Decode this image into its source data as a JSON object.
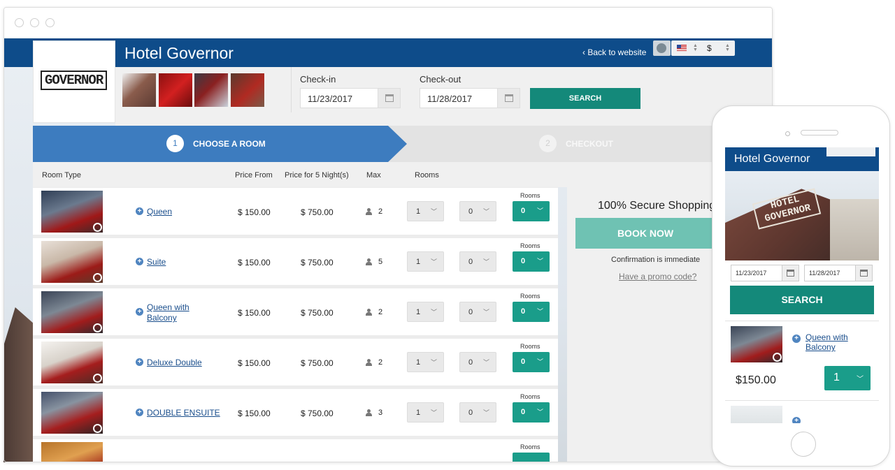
{
  "site": {
    "hotel_name": "Hotel Governor",
    "logo_text": "GOVERNOR",
    "back_link": "‹ Back to website",
    "currency": "$"
  },
  "search": {
    "checkin_label": "Check-in",
    "checkin_value": "11/23/2017",
    "checkout_label": "Check-out",
    "checkout_value": "11/28/2017",
    "button": "SEARCH"
  },
  "steps": [
    {
      "num": "1",
      "label": "CHOOSE A ROOM"
    },
    {
      "num": "2",
      "label": "CHECKOUT"
    }
  ],
  "columns": {
    "room_type": "Room Type",
    "price_from": "Price From",
    "price_nights": "Price for 5 Night(s)",
    "max": "Max",
    "rooms": "Rooms"
  },
  "rooms_small_label": "Rooms",
  "rooms": [
    {
      "name": "Queen",
      "price_from": "$ 150.00",
      "price_total": "$ 750.00",
      "max": "2",
      "sel1": "1",
      "sel2": "0",
      "rooms": "0"
    },
    {
      "name": "Suite",
      "price_from": "$ 150.00",
      "price_total": "$ 750.00",
      "max": "5",
      "sel1": "1",
      "sel2": "0",
      "rooms": "0"
    },
    {
      "name": "Queen with Balcony",
      "price_from": "$ 150.00",
      "price_total": "$ 750.00",
      "max": "2",
      "sel1": "1",
      "sel2": "0",
      "rooms": "0"
    },
    {
      "name": "Deluxe Double",
      "price_from": "$ 150.00",
      "price_total": "$ 750.00",
      "max": "2",
      "sel1": "1",
      "sel2": "0",
      "rooms": "0"
    },
    {
      "name": "DOUBLE ENSUITE",
      "price_from": "$ 150.00",
      "price_total": "$ 750.00",
      "max": "3",
      "sel1": "1",
      "sel2": "0",
      "rooms": "0"
    }
  ],
  "sidebar": {
    "title": "100% Secure Shopping",
    "book_button": "BOOK NOW",
    "confirmation": "Confirmation is immediate",
    "promo": "Have a promo code?"
  },
  "mobile": {
    "title": "Hotel Governor",
    "sign_text": "HOTEL GOVERNOR",
    "checkin": "11/23/2017",
    "checkout": "11/28/2017",
    "search": "SEARCH",
    "room_name": "Queen with Balcony",
    "price": "$150.00",
    "qty": "1"
  },
  "colors": {
    "brand_blue": "#0e4c8a",
    "step_blue": "#3d7cbf",
    "teal": "#14897a",
    "book_teal_light": "#6fc2b3",
    "link_blue": "#1a4e8c"
  }
}
